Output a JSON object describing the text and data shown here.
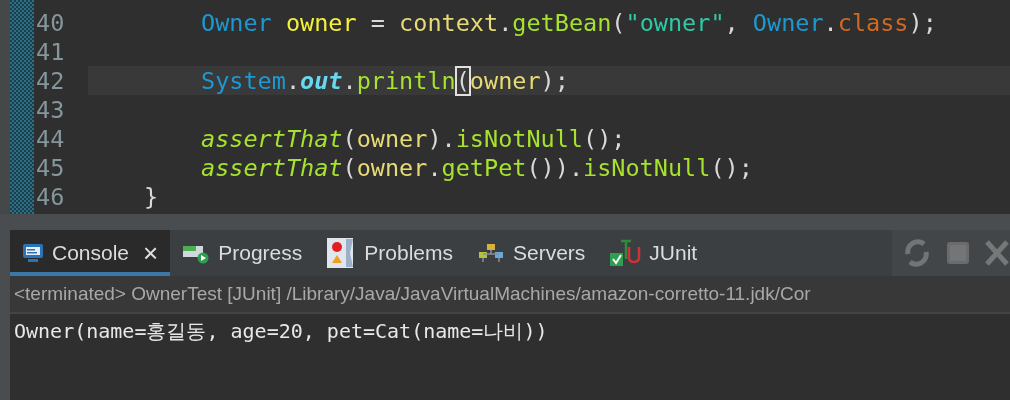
{
  "editor": {
    "lines": [
      {
        "number": "40",
        "current": false,
        "kind": "statement",
        "tokens": [
          {
            "kind": "type",
            "text": "Owner "
          },
          {
            "kind": "local",
            "text": "owner"
          },
          {
            "kind": "plain",
            "text": " = "
          },
          {
            "kind": "var",
            "text": "context"
          },
          {
            "kind": "plain",
            "text": "."
          },
          {
            "kind": "method",
            "text": "getBean"
          },
          {
            "kind": "plain",
            "text": "("
          },
          {
            "kind": "string",
            "text": "\"owner\""
          },
          {
            "kind": "plain",
            "text": ", "
          },
          {
            "kind": "type",
            "text": "Owner"
          },
          {
            "kind": "plain",
            "text": "."
          },
          {
            "kind": "keyword",
            "text": "class"
          },
          {
            "kind": "plain",
            "text": ");"
          }
        ]
      },
      {
        "number": "41",
        "current": false,
        "kind": "blank"
      },
      {
        "number": "42",
        "current": true,
        "kind": "statement",
        "tokens": [
          {
            "kind": "type",
            "text": "System"
          },
          {
            "kind": "plain",
            "text": "."
          },
          {
            "kind": "static",
            "text": "out"
          },
          {
            "kind": "plain",
            "text": "."
          },
          {
            "kind": "method",
            "text": "println"
          },
          {
            "kind": "match",
            "text": "("
          },
          {
            "kind": "var",
            "text": "owner"
          },
          {
            "kind": "plain",
            "text": ");"
          }
        ]
      },
      {
        "number": "43",
        "current": false,
        "kind": "blank"
      },
      {
        "number": "44",
        "current": false,
        "kind": "statement",
        "tokens": [
          {
            "kind": "static-method",
            "text": "assertThat"
          },
          {
            "kind": "plain",
            "text": "("
          },
          {
            "kind": "var",
            "text": "owner"
          },
          {
            "kind": "plain",
            "text": ")."
          },
          {
            "kind": "method",
            "text": "isNotNull"
          },
          {
            "kind": "plain",
            "text": "();"
          }
        ]
      },
      {
        "number": "45",
        "current": false,
        "kind": "statement",
        "tokens": [
          {
            "kind": "static-method",
            "text": "assertThat"
          },
          {
            "kind": "plain",
            "text": "("
          },
          {
            "kind": "var",
            "text": "owner"
          },
          {
            "kind": "plain",
            "text": "."
          },
          {
            "kind": "method",
            "text": "getPet"
          },
          {
            "kind": "plain",
            "text": "())."
          },
          {
            "kind": "method",
            "text": "isNotNull"
          },
          {
            "kind": "plain",
            "text": "();"
          }
        ]
      },
      {
        "number": "46",
        "current": false,
        "kind": "brace",
        "tokens": [
          {
            "kind": "plain",
            "text": "}"
          }
        ]
      }
    ]
  },
  "panel": {
    "tabs": [
      {
        "label": "Console",
        "kind": "console",
        "selected": true,
        "close": "×"
      },
      {
        "label": "Progress",
        "kind": "progress",
        "selected": false
      },
      {
        "label": "Problems",
        "kind": "problems",
        "selected": false
      },
      {
        "label": "Servers",
        "kind": "servers",
        "selected": false
      },
      {
        "label": "JUnit",
        "kind": "junit",
        "selected": false
      }
    ],
    "toolbar": [
      {
        "kind": "sync",
        "disabled": true
      },
      {
        "kind": "stop",
        "disabled": true
      },
      {
        "kind": "close",
        "disabled": true
      }
    ],
    "header": "<terminated> OwnerTest [JUnit] /Library/Java/JavaVirtualMachines/amazon-corretto-11.jdk/Cor",
    "output": [
      "Owner(name=홍길동, age=20, pet=Cat(name=나비))"
    ]
  }
}
